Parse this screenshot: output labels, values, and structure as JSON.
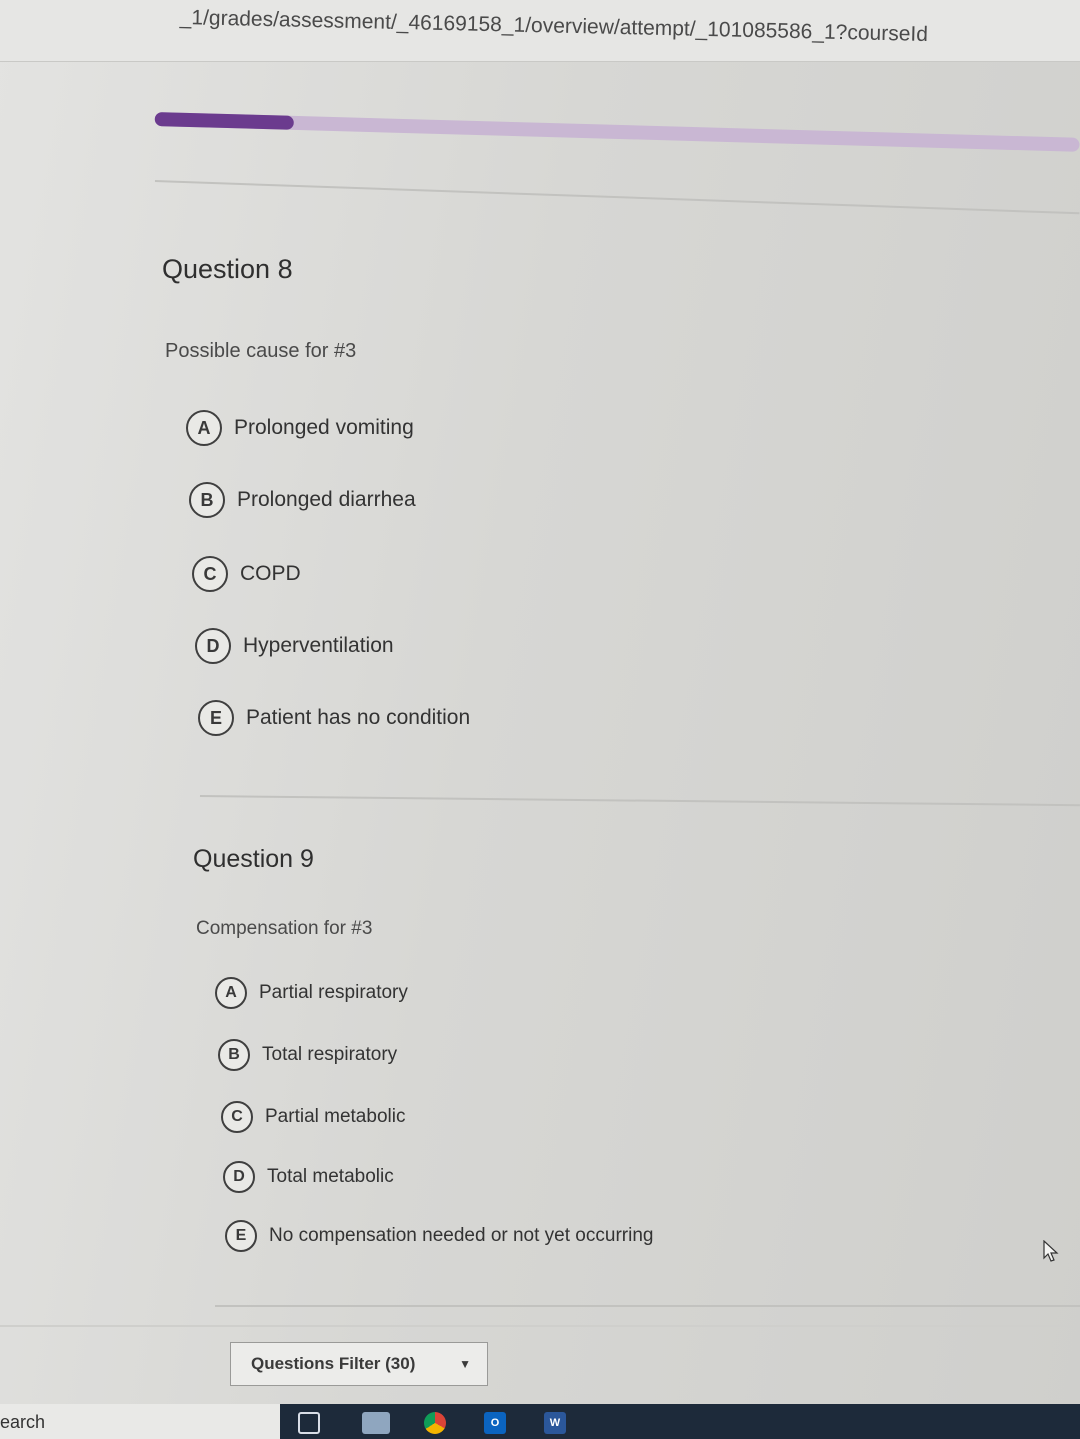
{
  "browser": {
    "url": "_1/grades/assessment/_46169158_1/overview/attempt/_101085586_1?courseId"
  },
  "progress": {
    "fraction": 0.15,
    "fill_color": "#6b3b8e",
    "track_color": "#c9b7d3"
  },
  "questions": [
    {
      "title": "Question 8",
      "prompt": "Possible cause for #3",
      "options": [
        {
          "letter": "A",
          "label": "Prolonged vomiting"
        },
        {
          "letter": "B",
          "label": "Prolonged diarrhea"
        },
        {
          "letter": "C",
          "label": "COPD"
        },
        {
          "letter": "D",
          "label": "Hyperventilation"
        },
        {
          "letter": "E",
          "label": "Patient has no condition"
        }
      ]
    },
    {
      "title": "Question 9",
      "prompt": "Compensation for #3",
      "options": [
        {
          "letter": "A",
          "label": "Partial respiratory"
        },
        {
          "letter": "B",
          "label": "Total respiratory"
        },
        {
          "letter": "C",
          "label": "Partial metabolic"
        },
        {
          "letter": "D",
          "label": "Total metabolic"
        },
        {
          "letter": "E",
          "label": "No compensation needed or not yet occurring"
        }
      ]
    }
  ],
  "filter": {
    "label": "Questions Filter (30)",
    "icon": "chevron-down-icon"
  },
  "taskbar": {
    "search_text": "earch",
    "icons": [
      "task-view-icon",
      "file-explorer-icon",
      "chrome-icon",
      "outlook-icon",
      "word-icon"
    ],
    "outlook_letter": "O",
    "word_letter": "W"
  }
}
